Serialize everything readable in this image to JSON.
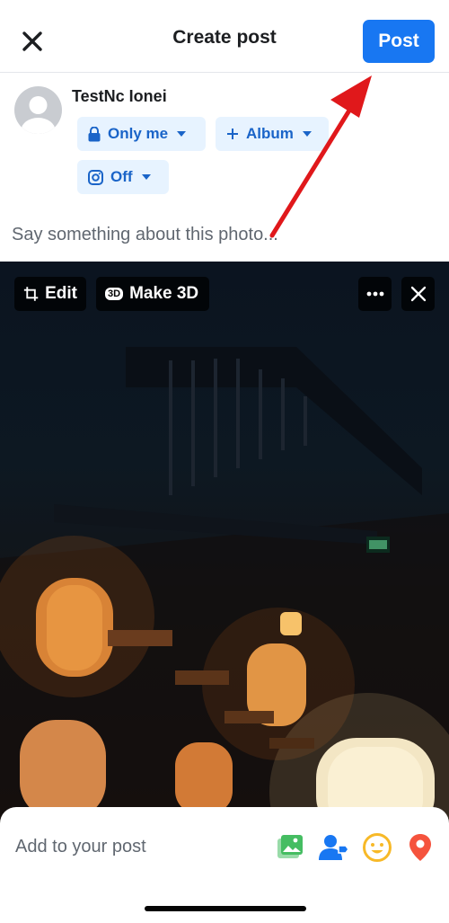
{
  "header": {
    "title": "Create post",
    "post_label": "Post"
  },
  "composer": {
    "username": "TestNc Ionei",
    "privacy_label": "Only me",
    "album_label": "Album",
    "instagram_label": "Off",
    "caption_placeholder": "Say something about this photo..."
  },
  "photo_controls": {
    "edit_label": "Edit",
    "make3d_label": "Make 3D",
    "make3d_badge": "3D"
  },
  "bottom_sheet": {
    "add_label": "Add to your post",
    "tools": [
      "photo-video-icon",
      "tag-people-icon",
      "feeling-icon",
      "check-in-icon"
    ]
  },
  "colors": {
    "accent": "#1877f2",
    "chip_bg": "#e7f3ff",
    "chip_text": "#1a64c8",
    "annotation_arrow": "#e0181b",
    "photo_icon": "#45bd62",
    "tag_icon": "#1877f2",
    "feeling_icon": "#f7b928",
    "checkin_icon": "#f5533d"
  }
}
